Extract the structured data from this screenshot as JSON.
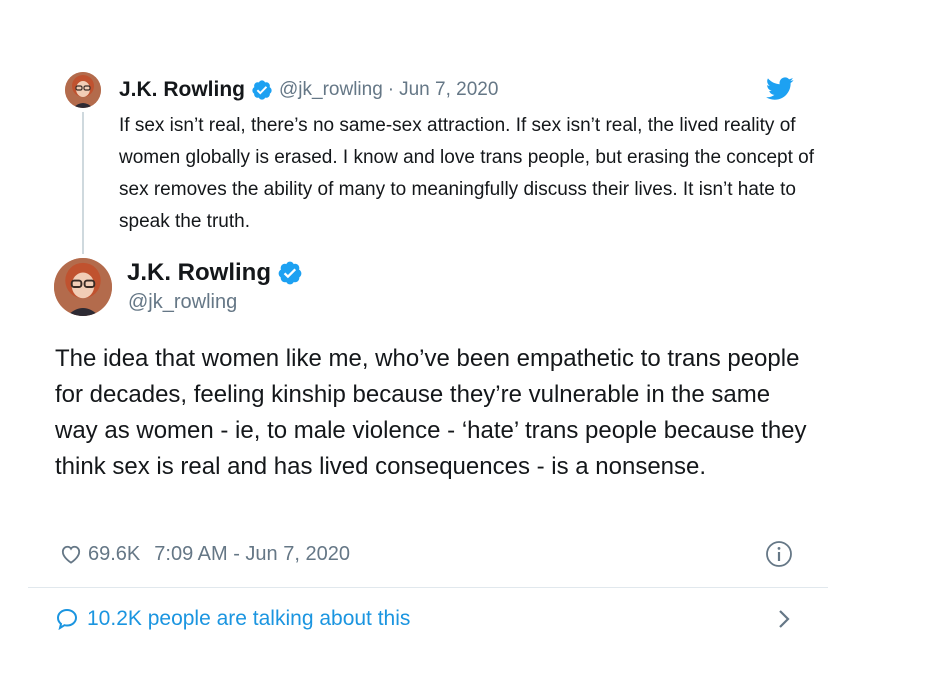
{
  "parent_tweet": {
    "author_name": "J.K. Rowling",
    "handle": "@jk_rowling",
    "separator": "·",
    "date": "Jun 7, 2020",
    "text": "If sex isn’t real, there’s no same-sex attraction. If sex isn’t real, the lived reality of women globally is erased. I know and love trans people, but erasing the concept of sex removes the ability of many to meaningfully discuss their lives. It isn’t hate to speak the truth."
  },
  "main_tweet": {
    "author_name": "J.K. Rowling",
    "handle": "@jk_rowling",
    "text": "The idea that women like me, who’ve been empathetic to trans people for decades, feeling kinship because they’re vulnerable in the same way as women - ie, to male violence - ‘hate’ trans people because they think sex is real and has lived consequences - is a nonsense."
  },
  "meta": {
    "like_count": "69.6K",
    "timestamp": "7:09 AM - Jun 7, 2020"
  },
  "conversation": {
    "label": "10.2K people are talking about this"
  },
  "icons": {
    "verified": "verified-badge-icon",
    "bird": "twitter-bird-icon",
    "heart": "heart-icon",
    "info": "info-icon",
    "bubble": "speech-bubble-icon",
    "chevron": "chevron-right-icon"
  },
  "colors": {
    "twitter_blue": "#1da1f2",
    "link_blue": "#1b95e0",
    "muted_gray": "#657786",
    "text": "#14171a",
    "divider": "#e1e8ed"
  }
}
